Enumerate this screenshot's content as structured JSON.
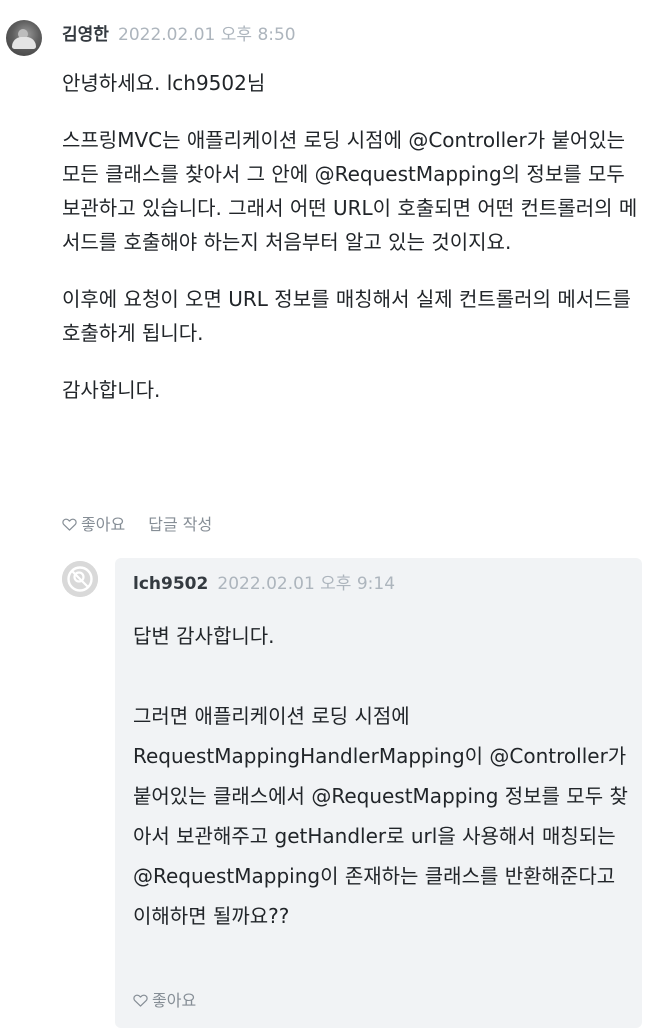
{
  "comment": {
    "author": "김영한",
    "date": "2022.02.01 오후 8:50",
    "paragraphs": [
      "안녕하세요. lch9502님",
      "스프링MVC는 애플리케이션 로딩 시점에 @Controller가 붙어있는 모든 클래스를 찾아서 그 안에 @RequestMapping의 정보를 모두 보관하고 있습니다. 그래서 어떤 URL이 호출되면 어떤 컨트롤러의 메서드를 호출해야 하는지 처음부터 알고 있는 것이지요.",
      "이후에 요청이 오면 URL 정보를 매칭해서 실제 컨트롤러의 메서드를 호출하게 됩니다.",
      "감사합니다."
    ],
    "like_label": "좋아요",
    "reply_label": "답글 작성"
  },
  "reply": {
    "author": "lch9502",
    "date": "2022.02.01 오후 9:14",
    "line1": "답변 감사합니다.",
    "line2": "그러면 애플리케이션 로딩 시점에 RequestMappingHandlerMapping이 @Controller가 붙어있는 클래스에서 @RequestMapping 정보를 모두 찾아서 보관해주고 getHandler로 url을 사용해서 매칭되는 @RequestMapping이 존재하는 클래스를 반환해준다고 이해하면 될까요??",
    "like_label": "좋아요"
  },
  "colors": {
    "text": "#212529",
    "muted": "#868e96",
    "date": "#adb5bd",
    "card_bg": "#f1f3f5"
  },
  "icons": {
    "like": "heart-outline-icon",
    "reply_avatar": "default-user-icon"
  }
}
